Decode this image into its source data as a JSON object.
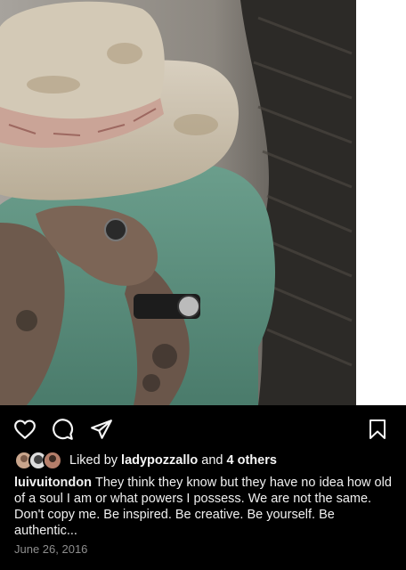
{
  "post": {
    "image_alt": "",
    "liked_by_prefix": "Liked by",
    "liked_by_user": "ladypozzallo",
    "liked_by_and": "and",
    "liked_by_others": "4 others",
    "caption_username": "luivuitondon",
    "caption_text": "They think they know but they have no idea how old of a soul I am or what powers I possess. We are not the same. Don't copy me. Be inspired. Be creative. Be yourself. Be authentic...",
    "date": "June 26, 2016"
  },
  "icons": {
    "like": "heart-icon",
    "comment": "comment-icon",
    "share": "send-icon",
    "save": "bookmark-icon"
  },
  "colors": {
    "background": "#000000",
    "text": "#f5f5f5",
    "muted": "#8e8e8e"
  }
}
